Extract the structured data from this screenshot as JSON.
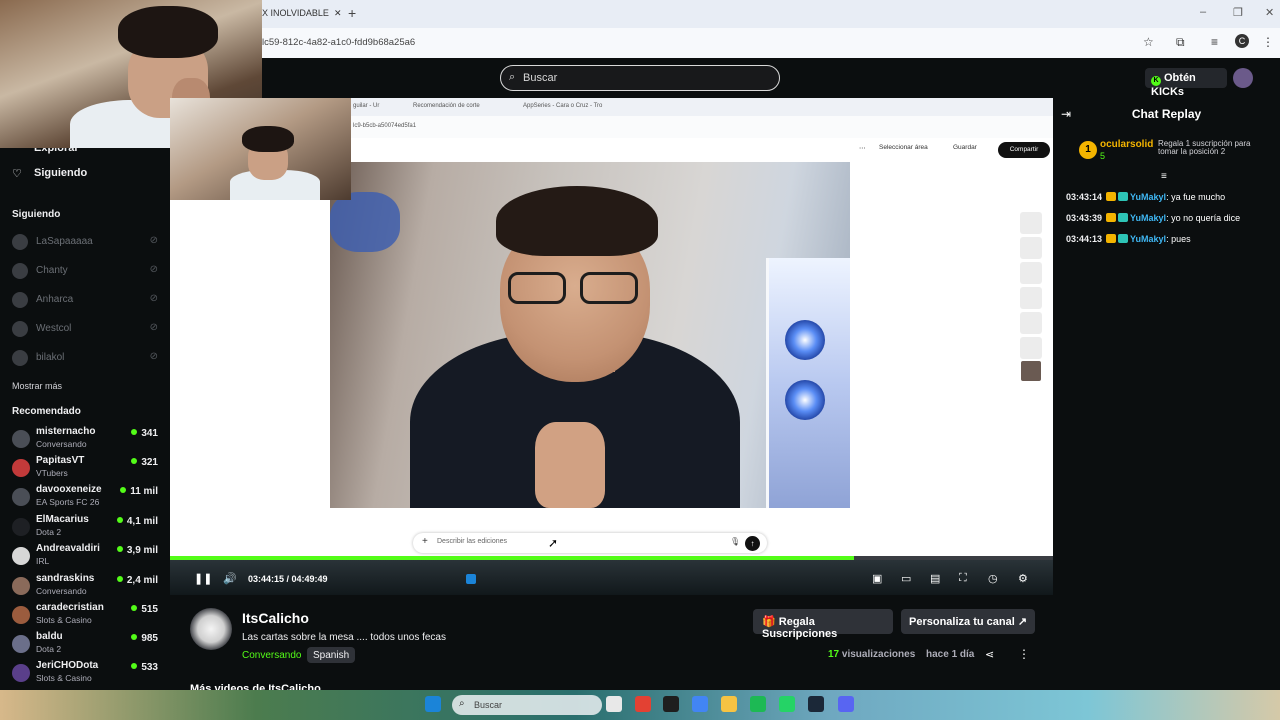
{
  "browser": {
    "tab_title": "X INOLVIDABLE",
    "new_tab": "+",
    "url_fragment": "lc59-812c-4a82-a1c0-fdd9b68a25a6",
    "window_controls": [
      "–",
      "❐",
      "✕"
    ]
  },
  "kick_header": {
    "search_placeholder": "Buscar",
    "kicks_button": "Obtén KICKs"
  },
  "sidebar": {
    "explore_label": "Explorar",
    "following_nav_label": "Siguiendo",
    "following_section_title": "Siguiendo",
    "following": [
      {
        "name": "LaSapaaaaa"
      },
      {
        "name": "Chanty"
      },
      {
        "name": "Anharca"
      },
      {
        "name": "Westcol"
      },
      {
        "name": "bilakol"
      }
    ],
    "show_more": "Mostrar más",
    "recommended_title": "Recomendado",
    "recommended": [
      {
        "name": "misternacho",
        "category": "Conversando",
        "viewers": "341"
      },
      {
        "name": "PapitasVT",
        "category": "VTubers",
        "viewers": "321"
      },
      {
        "name": "davooxeneize",
        "category": "EA Sports FC 26",
        "viewers": "11 mil"
      },
      {
        "name": "ElMacarius",
        "category": "Dota 2",
        "viewers": "4,1 mil"
      },
      {
        "name": "Andreavaldiri",
        "category": "IRL",
        "viewers": "3,9 mil"
      },
      {
        "name": "sandraskins",
        "category": "Conversando",
        "viewers": "2,4 mil"
      },
      {
        "name": "caradecristian",
        "category": "Slots & Casino",
        "viewers": "515"
      },
      {
        "name": "baldu",
        "category": "Dota 2",
        "viewers": "985"
      },
      {
        "name": "JeriCHODota",
        "category": "Slots & Casino",
        "viewers": "533"
      }
    ]
  },
  "inner_browser": {
    "tabs": [
      "guilar - Ur",
      "Recomendación de corte",
      "AppSeries - Cara o Cruz - Tro"
    ],
    "url": "lc9-b5cb-a50074ed5fa1",
    "select_area": "Seleccionar área",
    "save": "Guardar",
    "share": "Compartir",
    "edit_placeholder": "Describir las ediciones"
  },
  "player": {
    "time": "03:44:15 / 04:49:49",
    "progress_fraction": 0.775
  },
  "chat": {
    "title": "Chat Replay",
    "pinned": {
      "rank": "1",
      "user": "ocularsolid",
      "amount": "5",
      "text": "Regala 1 suscripción para tomar la posición 2"
    },
    "messages": [
      {
        "time": "03:43:14",
        "user": "YuMakyl",
        "text": "ya fue mucho"
      },
      {
        "time": "03:43:39",
        "user": "YuMakyl",
        "text": "yo no quería dice"
      },
      {
        "time": "03:44:13",
        "user": "YuMakyl",
        "text": "pues"
      }
    ]
  },
  "stream_info": {
    "channel": "ItsCalicho",
    "title": "Las cartas sobre la mesa .... todos unos fecas",
    "category": "Conversando",
    "language": "Spanish",
    "gift_button": "Regala Suscripciones",
    "customize_button": "Personaliza tu canal",
    "views_count": "17",
    "views_label": "visualizaciones",
    "ago": "hace 1 día",
    "more_videos": "Más videos de ItsCalicho"
  },
  "taskbar": {
    "search_placeholder": "Buscar"
  },
  "colors": {
    "kick_green": "#53fc18",
    "bg": "#0b0e0f",
    "chat_user": "#3fb6f2"
  }
}
